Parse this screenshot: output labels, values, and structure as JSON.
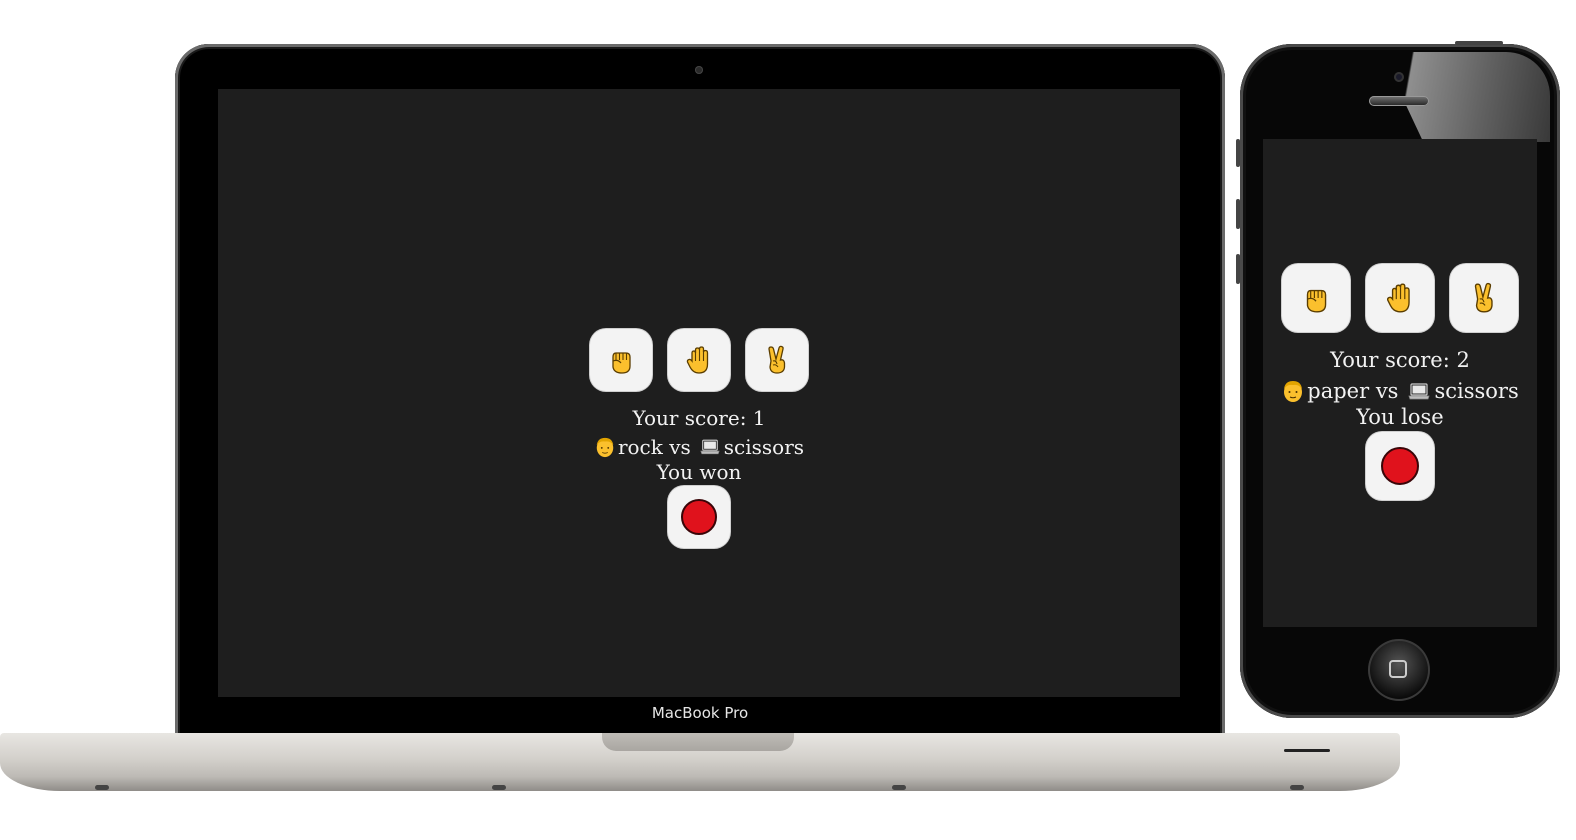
{
  "laptop": {
    "brand": "MacBook Pro",
    "app": {
      "choices": [
        {
          "name": "rock",
          "icon": "raised-fist-icon"
        },
        {
          "name": "paper",
          "icon": "raised-hand-icon"
        },
        {
          "name": "scissors",
          "icon": "victory-hand-icon"
        }
      ],
      "score_text": "Your score: 1",
      "player_choice": "rock",
      "vs": "vs",
      "computer_choice": "scissors",
      "result": "You won",
      "record_button_icon": "red-circle-icon"
    }
  },
  "phone": {
    "app": {
      "choices": [
        {
          "name": "rock",
          "icon": "raised-fist-icon"
        },
        {
          "name": "paper",
          "icon": "raised-hand-icon"
        },
        {
          "name": "scissors",
          "icon": "victory-hand-icon"
        }
      ],
      "score_text": "Your score: 2",
      "player_choice": "paper",
      "vs": "vs",
      "computer_choice": "scissors",
      "result": "You lose",
      "record_button_icon": "red-circle-icon"
    }
  },
  "colors": {
    "screen_bg": "#1e1e1e",
    "button_bg": "#f3f3f3",
    "record_red": "#e0121c",
    "emoji_yellow": "#fbc02d"
  }
}
